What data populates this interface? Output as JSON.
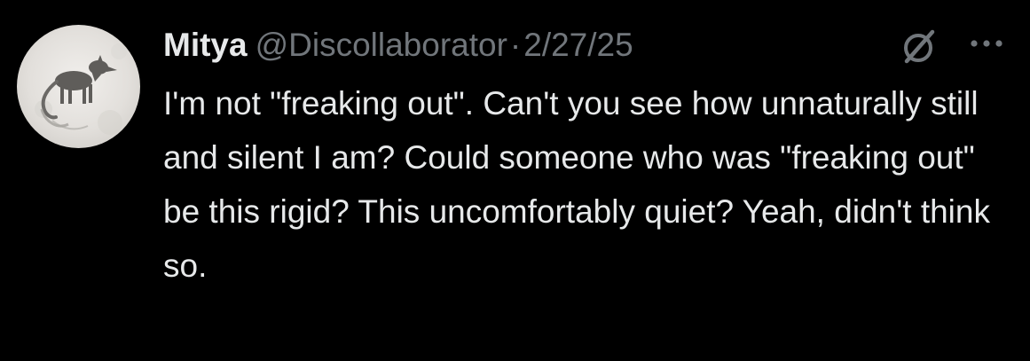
{
  "tweet": {
    "author_name": "Mitya",
    "handle": "@Discollaborator",
    "separator": "·",
    "date": "2/27/25",
    "text": "I'm not \"freaking out\". Can't you see how unnaturally still and silent I am? Could someone who was \"freaking out\" be this rigid? This uncomfortably quiet? Yeah, didn't think so."
  },
  "icons": {
    "avatar": "avatar-image",
    "grok": "grok-icon",
    "more": "more-options-icon"
  },
  "colors": {
    "background": "#000000",
    "primary_text": "#e7e9ea",
    "secondary_text": "#71767b"
  }
}
